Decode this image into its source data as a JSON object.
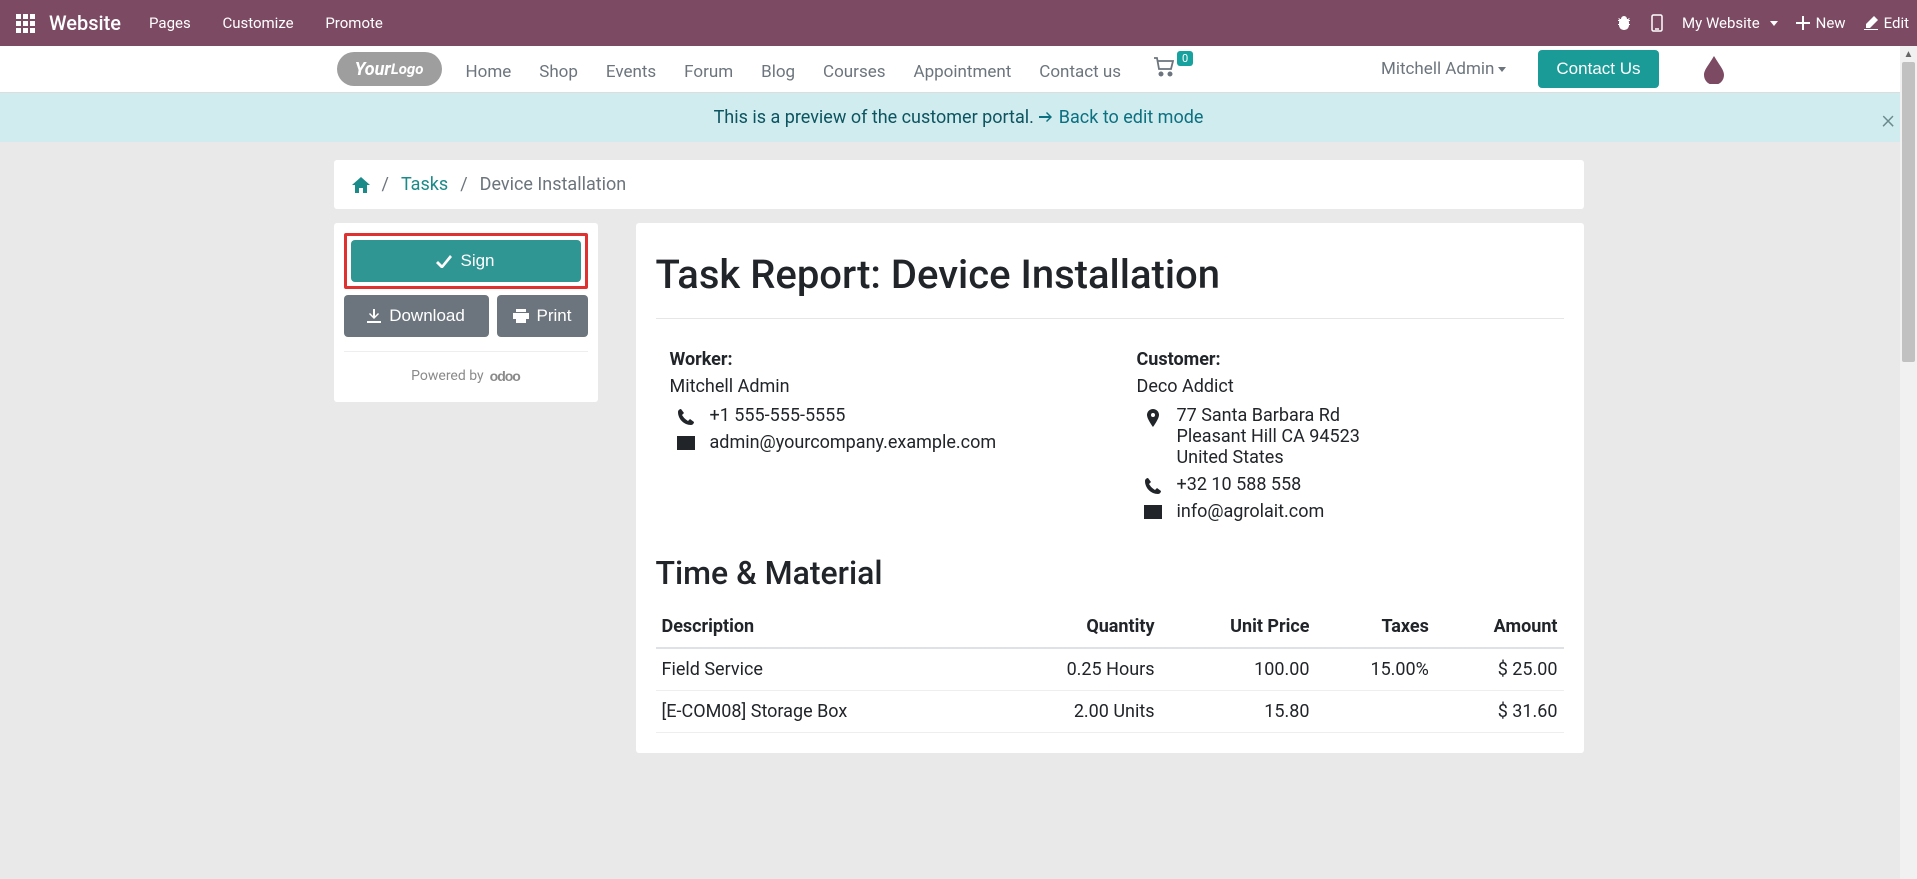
{
  "topbar": {
    "brand": "Website",
    "menu": [
      "Pages",
      "Customize",
      "Promote"
    ],
    "my_website": "My Website",
    "new": "New",
    "edit": "Edit"
  },
  "sitenav": {
    "items": [
      "Home",
      "Shop",
      "Events",
      "Forum",
      "Blog",
      "Courses",
      "Appointment",
      "Contact us"
    ],
    "cart_count": "0",
    "user": "Mitchell Admin",
    "contact_btn": "Contact Us"
  },
  "preview": {
    "text": "This is a preview of the customer portal. ",
    "link": "Back to edit mode"
  },
  "breadcrumb": {
    "tasks": "Tasks",
    "current": "Device Installation"
  },
  "sidebar": {
    "sign": "Sign",
    "download": "Download",
    "print": "Print",
    "powered": "Powered by",
    "odoo": "odoo"
  },
  "report": {
    "title": "Task Report: Device Installation",
    "worker_label": "Worker:",
    "worker_name": "Mitchell Admin",
    "worker_phone": "+1 555-555-5555",
    "worker_email": "admin@yourcompany.example.com",
    "customer_label": "Customer:",
    "customer_name": "Deco Addict",
    "customer_addr1": "77 Santa Barbara Rd",
    "customer_addr2": "Pleasant Hill CA 94523",
    "customer_addr3": "United States",
    "customer_phone": "+32 10 588 558",
    "customer_email": "info@agrolait.com",
    "tm_heading": "Time & Material",
    "cols": [
      "Description",
      "Quantity",
      "Unit Price",
      "Taxes",
      "Amount"
    ],
    "rows": [
      {
        "desc": "Field Service",
        "qty": "0.25 Hours",
        "price": "100.00",
        "tax": "15.00%",
        "amount": "$ 25.00"
      },
      {
        "desc": "[E-COM08] Storage Box",
        "qty": "2.00 Units",
        "price": "15.80",
        "tax": "",
        "amount": "$ 31.60"
      }
    ]
  }
}
